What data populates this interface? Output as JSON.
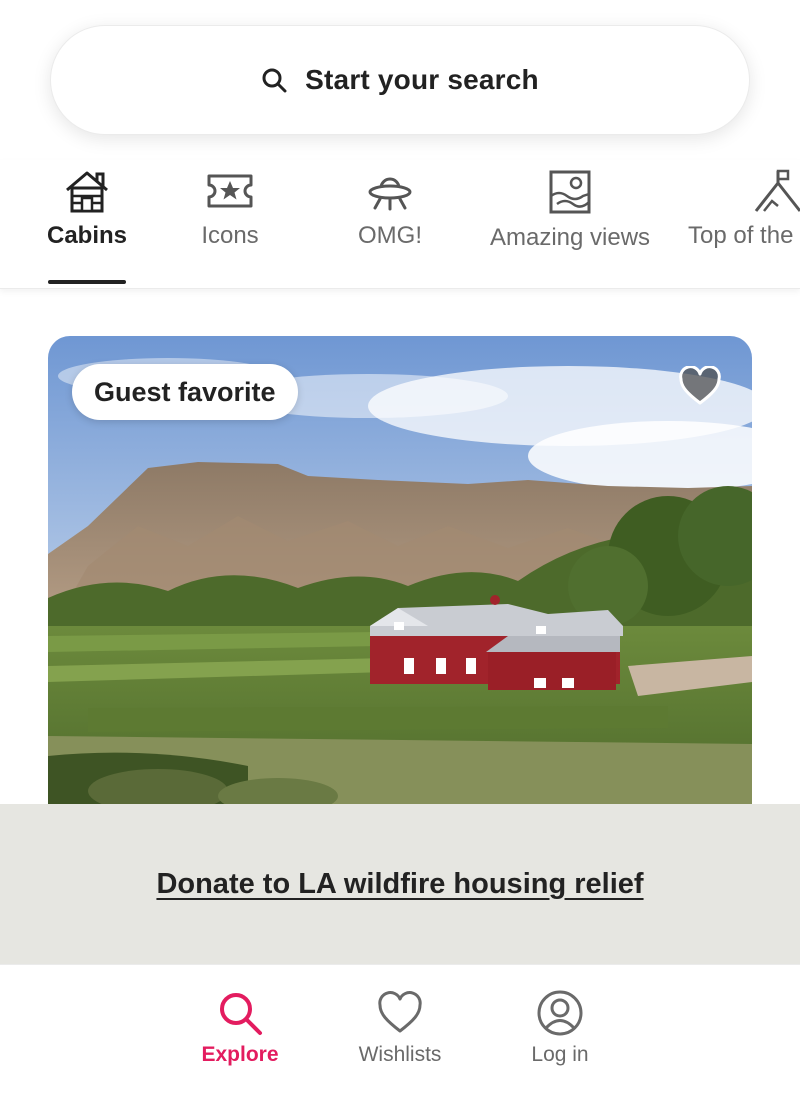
{
  "search": {
    "label": "Start your search",
    "icon": "search-icon"
  },
  "categories": [
    {
      "label": "Cabins",
      "icon": "cabin-icon",
      "active": true
    },
    {
      "label": "Icons",
      "icon": "ticket-star-icon",
      "active": false
    },
    {
      "label": "OMG!",
      "icon": "ufo-icon",
      "active": false
    },
    {
      "label": "Amazing views",
      "icon": "picture-frame-icon",
      "active": false
    },
    {
      "label": "Top of the world",
      "icon": "mountain-flag-icon",
      "active": false
    }
  ],
  "listing": {
    "badge": "Guest favorite",
    "wishlist_icon": "heart-icon"
  },
  "banner": {
    "link": "Donate to LA wildfire housing relief"
  },
  "bottom_nav": [
    {
      "label": "Explore",
      "icon": "search-icon",
      "active": true
    },
    {
      "label": "Wishlists",
      "icon": "heart-outline-icon",
      "active": false
    },
    {
      "label": "Log in",
      "icon": "user-circle-icon",
      "active": false
    }
  ],
  "colors": {
    "accent": "#e31c5f",
    "text": "#222222",
    "muted": "#6a6a6a",
    "banner_bg": "#e6e6e1"
  }
}
